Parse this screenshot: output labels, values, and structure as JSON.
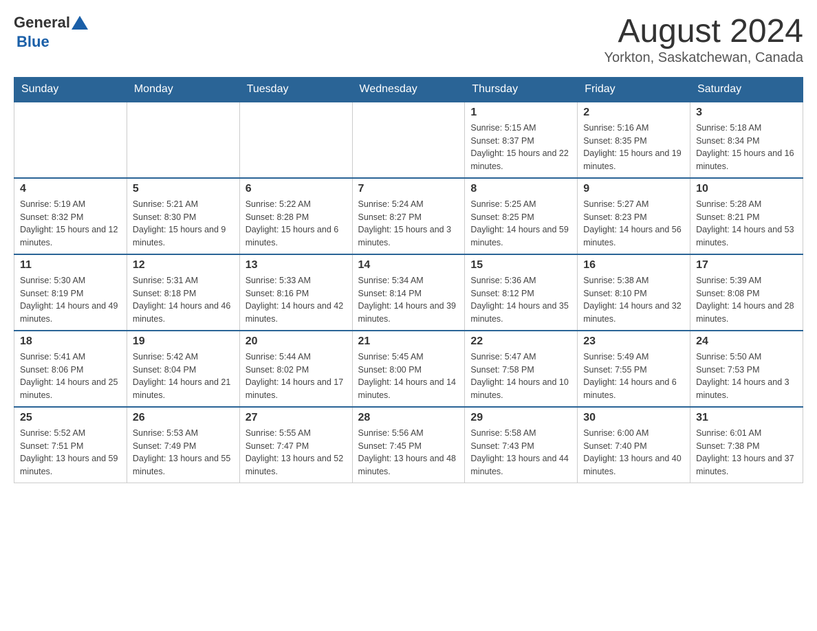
{
  "logo": {
    "text_general": "General",
    "text_blue": "Blue"
  },
  "header": {
    "title": "August 2024",
    "location": "Yorkton, Saskatchewan, Canada"
  },
  "days_of_week": [
    "Sunday",
    "Monday",
    "Tuesday",
    "Wednesday",
    "Thursday",
    "Friday",
    "Saturday"
  ],
  "weeks": [
    [
      {
        "day": "",
        "info": ""
      },
      {
        "day": "",
        "info": ""
      },
      {
        "day": "",
        "info": ""
      },
      {
        "day": "",
        "info": ""
      },
      {
        "day": "1",
        "info": "Sunrise: 5:15 AM\nSunset: 8:37 PM\nDaylight: 15 hours and 22 minutes."
      },
      {
        "day": "2",
        "info": "Sunrise: 5:16 AM\nSunset: 8:35 PM\nDaylight: 15 hours and 19 minutes."
      },
      {
        "day": "3",
        "info": "Sunrise: 5:18 AM\nSunset: 8:34 PM\nDaylight: 15 hours and 16 minutes."
      }
    ],
    [
      {
        "day": "4",
        "info": "Sunrise: 5:19 AM\nSunset: 8:32 PM\nDaylight: 15 hours and 12 minutes."
      },
      {
        "day": "5",
        "info": "Sunrise: 5:21 AM\nSunset: 8:30 PM\nDaylight: 15 hours and 9 minutes."
      },
      {
        "day": "6",
        "info": "Sunrise: 5:22 AM\nSunset: 8:28 PM\nDaylight: 15 hours and 6 minutes."
      },
      {
        "day": "7",
        "info": "Sunrise: 5:24 AM\nSunset: 8:27 PM\nDaylight: 15 hours and 3 minutes."
      },
      {
        "day": "8",
        "info": "Sunrise: 5:25 AM\nSunset: 8:25 PM\nDaylight: 14 hours and 59 minutes."
      },
      {
        "day": "9",
        "info": "Sunrise: 5:27 AM\nSunset: 8:23 PM\nDaylight: 14 hours and 56 minutes."
      },
      {
        "day": "10",
        "info": "Sunrise: 5:28 AM\nSunset: 8:21 PM\nDaylight: 14 hours and 53 minutes."
      }
    ],
    [
      {
        "day": "11",
        "info": "Sunrise: 5:30 AM\nSunset: 8:19 PM\nDaylight: 14 hours and 49 minutes."
      },
      {
        "day": "12",
        "info": "Sunrise: 5:31 AM\nSunset: 8:18 PM\nDaylight: 14 hours and 46 minutes."
      },
      {
        "day": "13",
        "info": "Sunrise: 5:33 AM\nSunset: 8:16 PM\nDaylight: 14 hours and 42 minutes."
      },
      {
        "day": "14",
        "info": "Sunrise: 5:34 AM\nSunset: 8:14 PM\nDaylight: 14 hours and 39 minutes."
      },
      {
        "day": "15",
        "info": "Sunrise: 5:36 AM\nSunset: 8:12 PM\nDaylight: 14 hours and 35 minutes."
      },
      {
        "day": "16",
        "info": "Sunrise: 5:38 AM\nSunset: 8:10 PM\nDaylight: 14 hours and 32 minutes."
      },
      {
        "day": "17",
        "info": "Sunrise: 5:39 AM\nSunset: 8:08 PM\nDaylight: 14 hours and 28 minutes."
      }
    ],
    [
      {
        "day": "18",
        "info": "Sunrise: 5:41 AM\nSunset: 8:06 PM\nDaylight: 14 hours and 25 minutes."
      },
      {
        "day": "19",
        "info": "Sunrise: 5:42 AM\nSunset: 8:04 PM\nDaylight: 14 hours and 21 minutes."
      },
      {
        "day": "20",
        "info": "Sunrise: 5:44 AM\nSunset: 8:02 PM\nDaylight: 14 hours and 17 minutes."
      },
      {
        "day": "21",
        "info": "Sunrise: 5:45 AM\nSunset: 8:00 PM\nDaylight: 14 hours and 14 minutes."
      },
      {
        "day": "22",
        "info": "Sunrise: 5:47 AM\nSunset: 7:58 PM\nDaylight: 14 hours and 10 minutes."
      },
      {
        "day": "23",
        "info": "Sunrise: 5:49 AM\nSunset: 7:55 PM\nDaylight: 14 hours and 6 minutes."
      },
      {
        "day": "24",
        "info": "Sunrise: 5:50 AM\nSunset: 7:53 PM\nDaylight: 14 hours and 3 minutes."
      }
    ],
    [
      {
        "day": "25",
        "info": "Sunrise: 5:52 AM\nSunset: 7:51 PM\nDaylight: 13 hours and 59 minutes."
      },
      {
        "day": "26",
        "info": "Sunrise: 5:53 AM\nSunset: 7:49 PM\nDaylight: 13 hours and 55 minutes."
      },
      {
        "day": "27",
        "info": "Sunrise: 5:55 AM\nSunset: 7:47 PM\nDaylight: 13 hours and 52 minutes."
      },
      {
        "day": "28",
        "info": "Sunrise: 5:56 AM\nSunset: 7:45 PM\nDaylight: 13 hours and 48 minutes."
      },
      {
        "day": "29",
        "info": "Sunrise: 5:58 AM\nSunset: 7:43 PM\nDaylight: 13 hours and 44 minutes."
      },
      {
        "day": "30",
        "info": "Sunrise: 6:00 AM\nSunset: 7:40 PM\nDaylight: 13 hours and 40 minutes."
      },
      {
        "day": "31",
        "info": "Sunrise: 6:01 AM\nSunset: 7:38 PM\nDaylight: 13 hours and 37 minutes."
      }
    ]
  ]
}
